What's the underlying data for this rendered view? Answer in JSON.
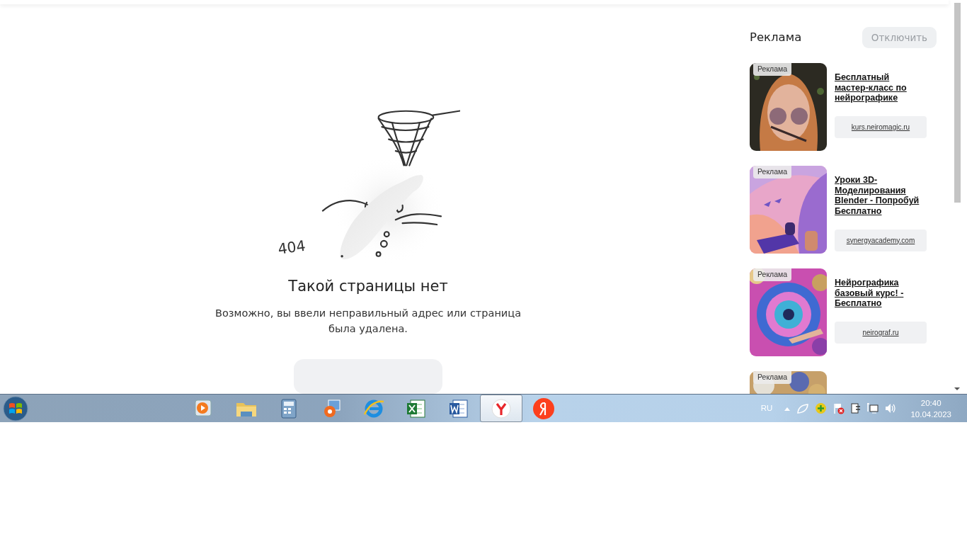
{
  "main": {
    "illustration_label": "404",
    "title": "Такой страницы нет",
    "text": "Возможно, вы ввели неправильный адрес или страница была удалена."
  },
  "ads": {
    "heading": "Реклама",
    "disable_button": "Отключить",
    "items": [
      {
        "label": "Реклама",
        "title": "Бесплатный мастер-класс по нейрографике",
        "url": "kurs.neiromagic.ru"
      },
      {
        "label": "Реклама",
        "title": "Уроки 3D-Моделирования Blender - Попробуй Бесплатно",
        "url": "synergyacademy.com"
      },
      {
        "label": "Реклама",
        "title": "Нейрографика базовый курс! - Бесплатно",
        "url": "neirograf.ru"
      },
      {
        "label": "Реклама"
      }
    ]
  },
  "taskbar": {
    "apps": [
      {
        "kind": "media",
        "selected": false
      },
      {
        "kind": "folder",
        "selected": false
      },
      {
        "kind": "calculator",
        "selected": false
      },
      {
        "kind": "photos",
        "selected": false
      },
      {
        "kind": "ie",
        "selected": false
      },
      {
        "kind": "excel",
        "selected": false
      },
      {
        "kind": "word",
        "selected": false
      },
      {
        "kind": "ybrowser",
        "selected": true
      },
      {
        "kind": "yandex",
        "selected": false
      }
    ],
    "language": "RU",
    "time": "20:40",
    "date": "10.04.2023"
  }
}
